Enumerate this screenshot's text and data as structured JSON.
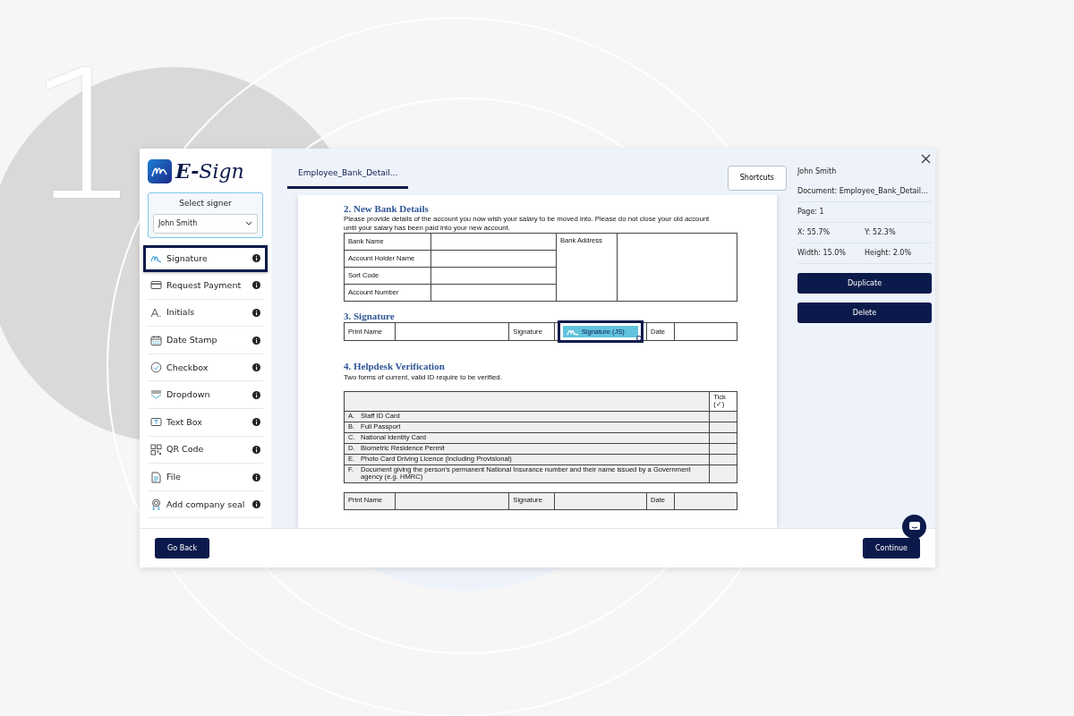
{
  "step_number": "1",
  "logo": {
    "text": "**E-**Sign"
  },
  "signer": {
    "label": "Select signer",
    "value": "John Smith"
  },
  "tools": [
    {
      "kind": "signature",
      "label": "Signature",
      "selected": true
    },
    {
      "kind": "payment",
      "label": "Request Payment",
      "selected": false
    },
    {
      "kind": "initials",
      "label": "Initials",
      "selected": false
    },
    {
      "kind": "date",
      "label": "Date Stamp",
      "selected": false
    },
    {
      "kind": "checkbox",
      "label": "Checkbox",
      "selected": false
    },
    {
      "kind": "dropdown",
      "label": "Dropdown",
      "selected": false
    },
    {
      "kind": "textbox",
      "label": "Text Box",
      "selected": false
    },
    {
      "kind": "qr",
      "label": "QR Code",
      "selected": false
    },
    {
      "kind": "file",
      "label": "File",
      "selected": false
    },
    {
      "kind": "seal",
      "label": "Add company seal",
      "selected": false
    }
  ],
  "tabs": [
    {
      "label": "Employee_Bank_Detail...",
      "selected": true
    }
  ],
  "shortcuts": "Shortcuts",
  "document": {
    "bank": {
      "heading": "2. New Bank Details",
      "intro": "Please provide details of the account you now wish your salary to be moved into.  Please do not close your old account until your salary has been paid into your new account.",
      "fields": [
        "Bank Name",
        "Account Holder Name",
        "Sort Code",
        "Account Number"
      ],
      "address_label": "Bank Address"
    },
    "signature": {
      "heading": "3. Signature",
      "cells": [
        {
          "kind": "label",
          "text": "Print Name"
        },
        {
          "kind": "blank"
        },
        {
          "kind": "label",
          "text": "Signature"
        },
        {
          "kind": "field",
          "text": "Signature (JS)",
          "selected": true
        },
        {
          "kind": "label",
          "text": "Date"
        },
        {
          "kind": "blank"
        }
      ]
    },
    "helpdesk": {
      "heading": "4. Helpdesk Verification",
      "intro": "Two forms of current, valid ID require to be verified.",
      "tick_header": "Tick (✓)",
      "items": [
        {
          "letter": "A.",
          "text": "Staff ID Card"
        },
        {
          "letter": "B.",
          "text": "Full Passport"
        },
        {
          "letter": "C.",
          "text": "National Identity Card"
        },
        {
          "letter": "D.",
          "text": "Biometric Residence Permit"
        },
        {
          "letter": "E.",
          "text": "Photo Card Driving Licence (including Provisional)"
        },
        {
          "letter": "F.",
          "text": "Document giving the person's permanent National Insurance number and their name issued by a Government agency (e.g. HMRC)"
        }
      ],
      "sign_cells": [
        {
          "kind": "label",
          "text": "Print Name"
        },
        {
          "kind": "blank"
        },
        {
          "kind": "label",
          "text": "Signature"
        },
        {
          "kind": "blank"
        },
        {
          "kind": "label",
          "text": "Date"
        },
        {
          "kind": "blank"
        }
      ]
    }
  },
  "details": {
    "name": "John Smith",
    "document": "Document: Employee_Bank_Detail...",
    "page": "Page: 1",
    "x": "X: 55.7%",
    "y": "Y: 52.3%",
    "width": "Width: 15.0%",
    "height": "Height: 2.0%"
  },
  "actions": [
    "Duplicate",
    "Delete"
  ],
  "footer": {
    "back": "Go Back",
    "next": "Continue"
  }
}
